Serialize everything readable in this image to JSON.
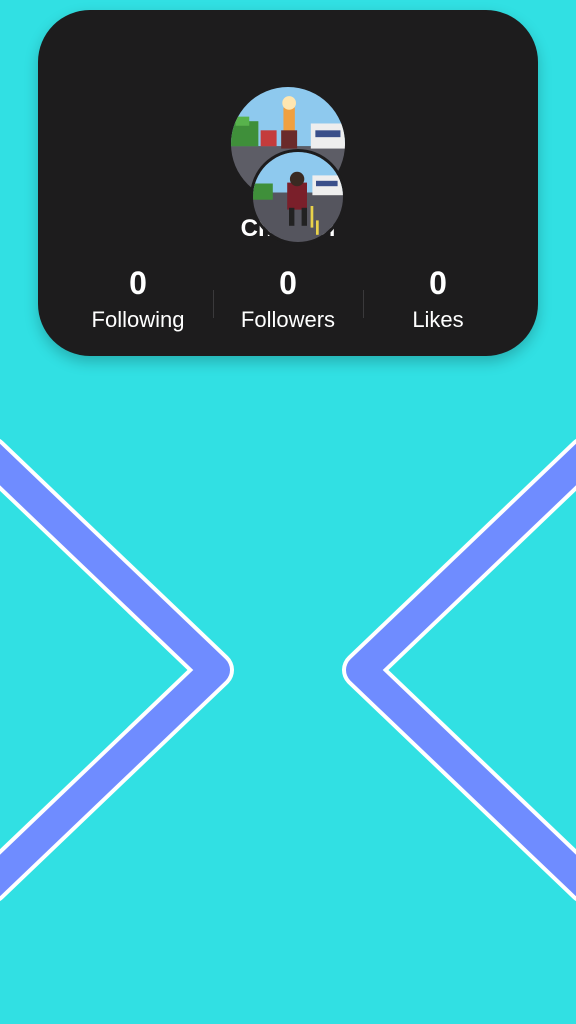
{
  "profile": {
    "username": "Chaoyin",
    "stats": [
      {
        "count": "0",
        "label": "Following"
      },
      {
        "count": "0",
        "label": "Followers"
      },
      {
        "count": "0",
        "label": "Likes"
      }
    ]
  },
  "colors": {
    "background": "#31e0e3",
    "card": "#1d1c1d",
    "chevron": "#6f8cff",
    "chevron_outline": "#ffffff"
  },
  "navigation": {
    "left_icon": "chevron-left-icon",
    "right_icon": "chevron-right-icon"
  }
}
